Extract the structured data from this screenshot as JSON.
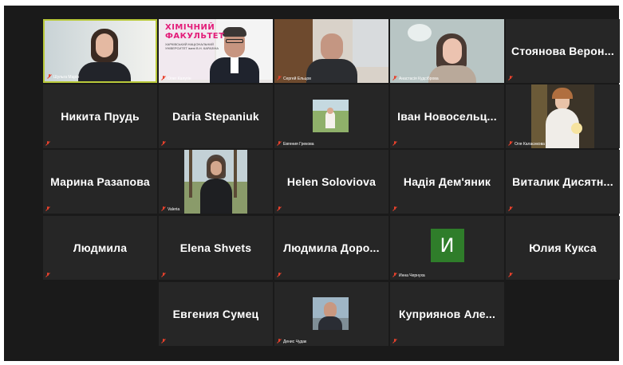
{
  "participants": [
    {
      "id": "p1",
      "label": "Шульга Марія",
      "type": "video",
      "active": true
    },
    {
      "id": "p2",
      "label": "Олег Калугін",
      "type": "video",
      "sign_title": "ХІМІЧНИЙ ФАКУЛЬТЕТ",
      "sign_sub": "ХАРКІВСЬКИЙ НАЦІОНАЛЬНИЙ УНІВЕРСИТЕТ імені В.Н. КАРАЗІНА"
    },
    {
      "id": "p3",
      "label": "Сергей Ельцов",
      "type": "video"
    },
    {
      "id": "p4",
      "label": "Анастасія Кудсіброва",
      "type": "video"
    },
    {
      "id": "p5",
      "name": "Стоянова Верон...",
      "type": "name"
    },
    {
      "id": "p6",
      "name": "Никита Прудь",
      "type": "name"
    },
    {
      "id": "p7",
      "name": "Daria Stepaniuk",
      "type": "name"
    },
    {
      "id": "p8",
      "label": "Евгения Грекова",
      "type": "photo"
    },
    {
      "id": "p9",
      "name": "Іван Новосельц...",
      "type": "name"
    },
    {
      "id": "p10",
      "label": "Оля Калаєнкова",
      "type": "photo"
    },
    {
      "id": "p11",
      "name": "Марина Разапова",
      "type": "name"
    },
    {
      "id": "p12",
      "label": "Valeria",
      "type": "photo"
    },
    {
      "id": "p13",
      "name": "Helen Soloviova",
      "type": "name"
    },
    {
      "id": "p14",
      "name": "Надія Дем'яник",
      "type": "name"
    },
    {
      "id": "p15",
      "name": "Виталик Дисятн...",
      "type": "name"
    },
    {
      "id": "p16",
      "name": "Людмила",
      "type": "name"
    },
    {
      "id": "p17",
      "name": "Elena Shvets",
      "type": "name"
    },
    {
      "id": "p18",
      "name": "Людмила Доро...",
      "type": "name"
    },
    {
      "id": "p19",
      "label": "Инна Чернуха",
      "type": "avatar",
      "initial": "И"
    },
    {
      "id": "p20",
      "name": "Юлия Кукса",
      "type": "name"
    },
    {
      "id": "p21",
      "name": "Евгения Сумец",
      "type": "name"
    },
    {
      "id": "p22",
      "label": "Денис Чудак",
      "type": "photo"
    },
    {
      "id": "p23",
      "name": "Куприянов Але...",
      "type": "name"
    }
  ],
  "colors": {
    "background": "#1a1a1a",
    "tile": "#262626",
    "active_border": "#b9c93a",
    "mic_muted": "#e8412c",
    "avatar": "#2f7d2a"
  },
  "icons": {
    "mic": "microphone-muted-icon"
  }
}
